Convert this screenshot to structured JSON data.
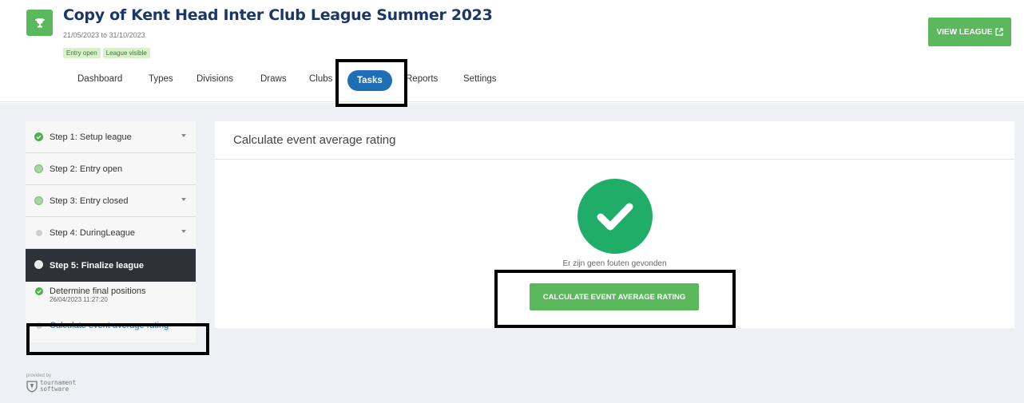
{
  "header": {
    "title": "Copy of Kent Head Inter Club League Summer 2023",
    "dates": "21/05/2023 to 31/10/2023",
    "badges": [
      "Entry open",
      "League visible"
    ],
    "view_league_label": "VIEW LEAGUE"
  },
  "tabs": [
    "Dashboard",
    "Types",
    "Divisions",
    "Draws",
    "Clubs",
    "Tasks",
    "Reports",
    "Settings"
  ],
  "active_tab": "Tasks",
  "sidebar": {
    "steps": [
      {
        "label": "Step 1: Setup league",
        "status": "done"
      },
      {
        "label": "Step 2: Entry open",
        "status": "open"
      },
      {
        "label": "Step 3: Entry closed",
        "status": "open"
      },
      {
        "label": "Step 4: DuringLeague",
        "status": "pending"
      },
      {
        "label": "Step 5: Finalize league",
        "status": "active"
      }
    ],
    "subtasks": [
      {
        "label": "Determine final positions",
        "timestamp": "26/04/2023 11:27:20",
        "status": "done"
      },
      {
        "label": "Calculate event average rating",
        "status": "pending"
      }
    ]
  },
  "footer": {
    "provided_by": "provided by",
    "logo_line1": "tournament",
    "logo_line2": "software"
  },
  "panel": {
    "title": "Calculate event average rating",
    "message": "Er zijn geen fouten gevonden",
    "button_label": "CALCULATE EVENT AVERAGE RATING"
  },
  "colors": {
    "green": "#5cb85c",
    "check_green": "#1fad67",
    "navy_title": "#1b3668",
    "active_tab": "#1f6fb7",
    "sidebar_active": "#2e3238"
  }
}
